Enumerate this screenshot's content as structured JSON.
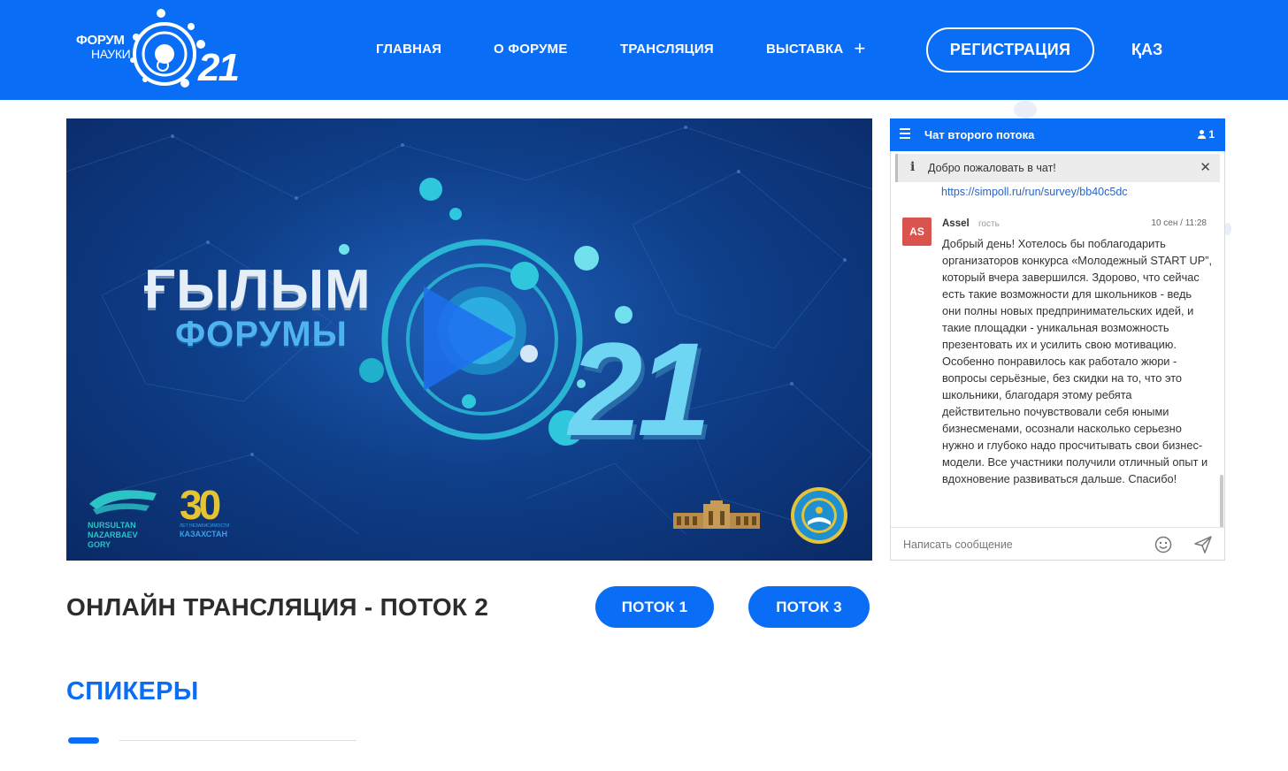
{
  "header": {
    "logo": {
      "word1": "ФОРУМ",
      "word2": "НАУКИ",
      "number": "21"
    },
    "nav": [
      {
        "label": "ГЛАВНАЯ"
      },
      {
        "label": "О ФОРУМЕ"
      },
      {
        "label": "ТРАНСЛЯЦИЯ"
      },
      {
        "label": "ВЫСТАВКА",
        "icon": "plus-icon"
      }
    ],
    "register_label": "РЕГИСТРАЦИЯ",
    "lang_label": "ҚАЗ"
  },
  "video": {
    "title_line1": "ҒЫЛЫМ",
    "title_line2": "ФОРУМЫ",
    "number": "21",
    "play_icon": "play-icon",
    "partner1": [
      "NURSULTAN",
      "NAZARBAEV",
      "GORY"
    ],
    "partner2_number": "30",
    "partner2_small": "ЛЕТ НЕЗАВИСИМОСТИ",
    "partner2_country": "КАЗАХСТАН"
  },
  "chat": {
    "title": "Чат второго потока",
    "users_count": "1",
    "notice": "Добро пожаловать в чат!",
    "prev_link": "https://simpoll.ru/run/survey/bb40c5dc",
    "message": {
      "avatar": "AS",
      "author": "Assel",
      "role": "гость",
      "time": "10 сен / 11:28",
      "text": "Добрый день! Хотелось бы поблагодарить организаторов конкурса «Молодежный START UP”, который вчера завершился. Здорово, что сейчас есть такие возможности для школьников - ведь они полны новых предпринимательских идей, и такие площадки - уникальная возможность презентовать их и усилить свою мотивацию. Особенно понравилось как работало жюри - вопросы серьёзные, без скидки на то, что это школьники, благодаря этому ребята действительно почувствовали себя юными бизнесменами, осознали насколько серьезно нужно и глубоко надо просчитывать свои бизнес-модели. Все участники получили отличный опыт и вдохновение развиваться дальше. Спасибо!"
    },
    "input_placeholder": "Написать сообщение"
  },
  "main": {
    "page_title": "ОНЛАЙН ТРАНСЛЯЦИЯ - ПОТОК 2",
    "stream_buttons": [
      {
        "label": "ПОТОК 1"
      },
      {
        "label": "ПОТОК 3"
      }
    ],
    "speakers_title": "СПИКЕРЫ"
  },
  "colors": {
    "brand": "#0a6df5",
    "avatar": "#d9534f",
    "title": "#2c2c2c"
  }
}
